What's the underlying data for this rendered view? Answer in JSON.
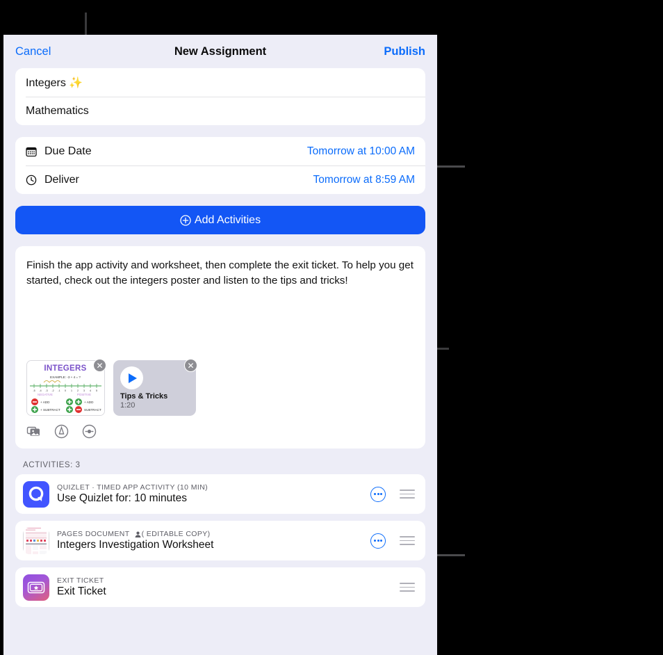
{
  "navbar": {
    "cancel_label": "Cancel",
    "title": "New Assignment",
    "publish_label": "Publish"
  },
  "title_card": {
    "assignment_title": "Integers ✨",
    "subject": "Mathematics"
  },
  "schedule": {
    "due_date_label": "Due Date",
    "due_date_value": "Tomorrow at 10:00 AM",
    "deliver_label": "Deliver",
    "deliver_value": "Tomorrow at 8:59 AM",
    "due_date_icon": "calendar-icon",
    "deliver_icon": "clock-icon"
  },
  "add_activities": {
    "label": "Add Activities",
    "icon": "plus-circle-icon",
    "accent": "#1356F5"
  },
  "notes": {
    "text": "Finish the app activity and worksheet, then complete the exit ticket. To help you get started, check out the integers poster and listen to the tips and tricks!",
    "attachments": [
      {
        "name": "Integers poster",
        "type": "image",
        "heading": "INTEGERS",
        "example": "EXAMPLE: -3 + 4 = ?",
        "legend": [
          "+ ADD",
          "- SUBTRACT",
          "+ ADD",
          "- SUBTRACT"
        ],
        "remove_icon": "close-circle-icon"
      },
      {
        "name": "Tips & Tricks",
        "type": "audio",
        "title": "Tips & Tricks",
        "duration": "1:20",
        "play_icon": "play-icon",
        "remove_icon": "close-circle-icon"
      }
    ],
    "toolbar_icons": [
      "photos-icon",
      "markup-icon",
      "audio-record-icon"
    ]
  },
  "activities": {
    "section_label": "ACTIVITIES: 3",
    "count": 3,
    "items": [
      {
        "kicker": "QUIZLET · TIMED APP ACTIVITY (10 MIN)",
        "title": "Use Quizlet for: 10 minutes",
        "icon": "quizlet-icon",
        "icon_color": "#4255FF",
        "has_more": true,
        "has_handle": true,
        "editable_copy": false
      },
      {
        "kicker": "PAGES DOCUMENT",
        "kicker_suffix": "( EDITABLE COPY)",
        "title": "Integers Investigation Worksheet",
        "icon": "pages-document-icon",
        "has_more": true,
        "has_handle": true,
        "editable_copy": true,
        "person_icon": "person-icon"
      },
      {
        "kicker": "EXIT TICKET",
        "title": "Exit Ticket",
        "icon": "exit-ticket-icon",
        "has_more": false,
        "has_handle": true,
        "editable_copy": false
      }
    ]
  },
  "annotations": {
    "callout_title_line": "vertical-leader-line",
    "callout_schedule_bracket": "schedule-bracket",
    "callout_attachments_line": "horizontal-leader-line",
    "callout_activities_bracket": "activities-bracket"
  }
}
